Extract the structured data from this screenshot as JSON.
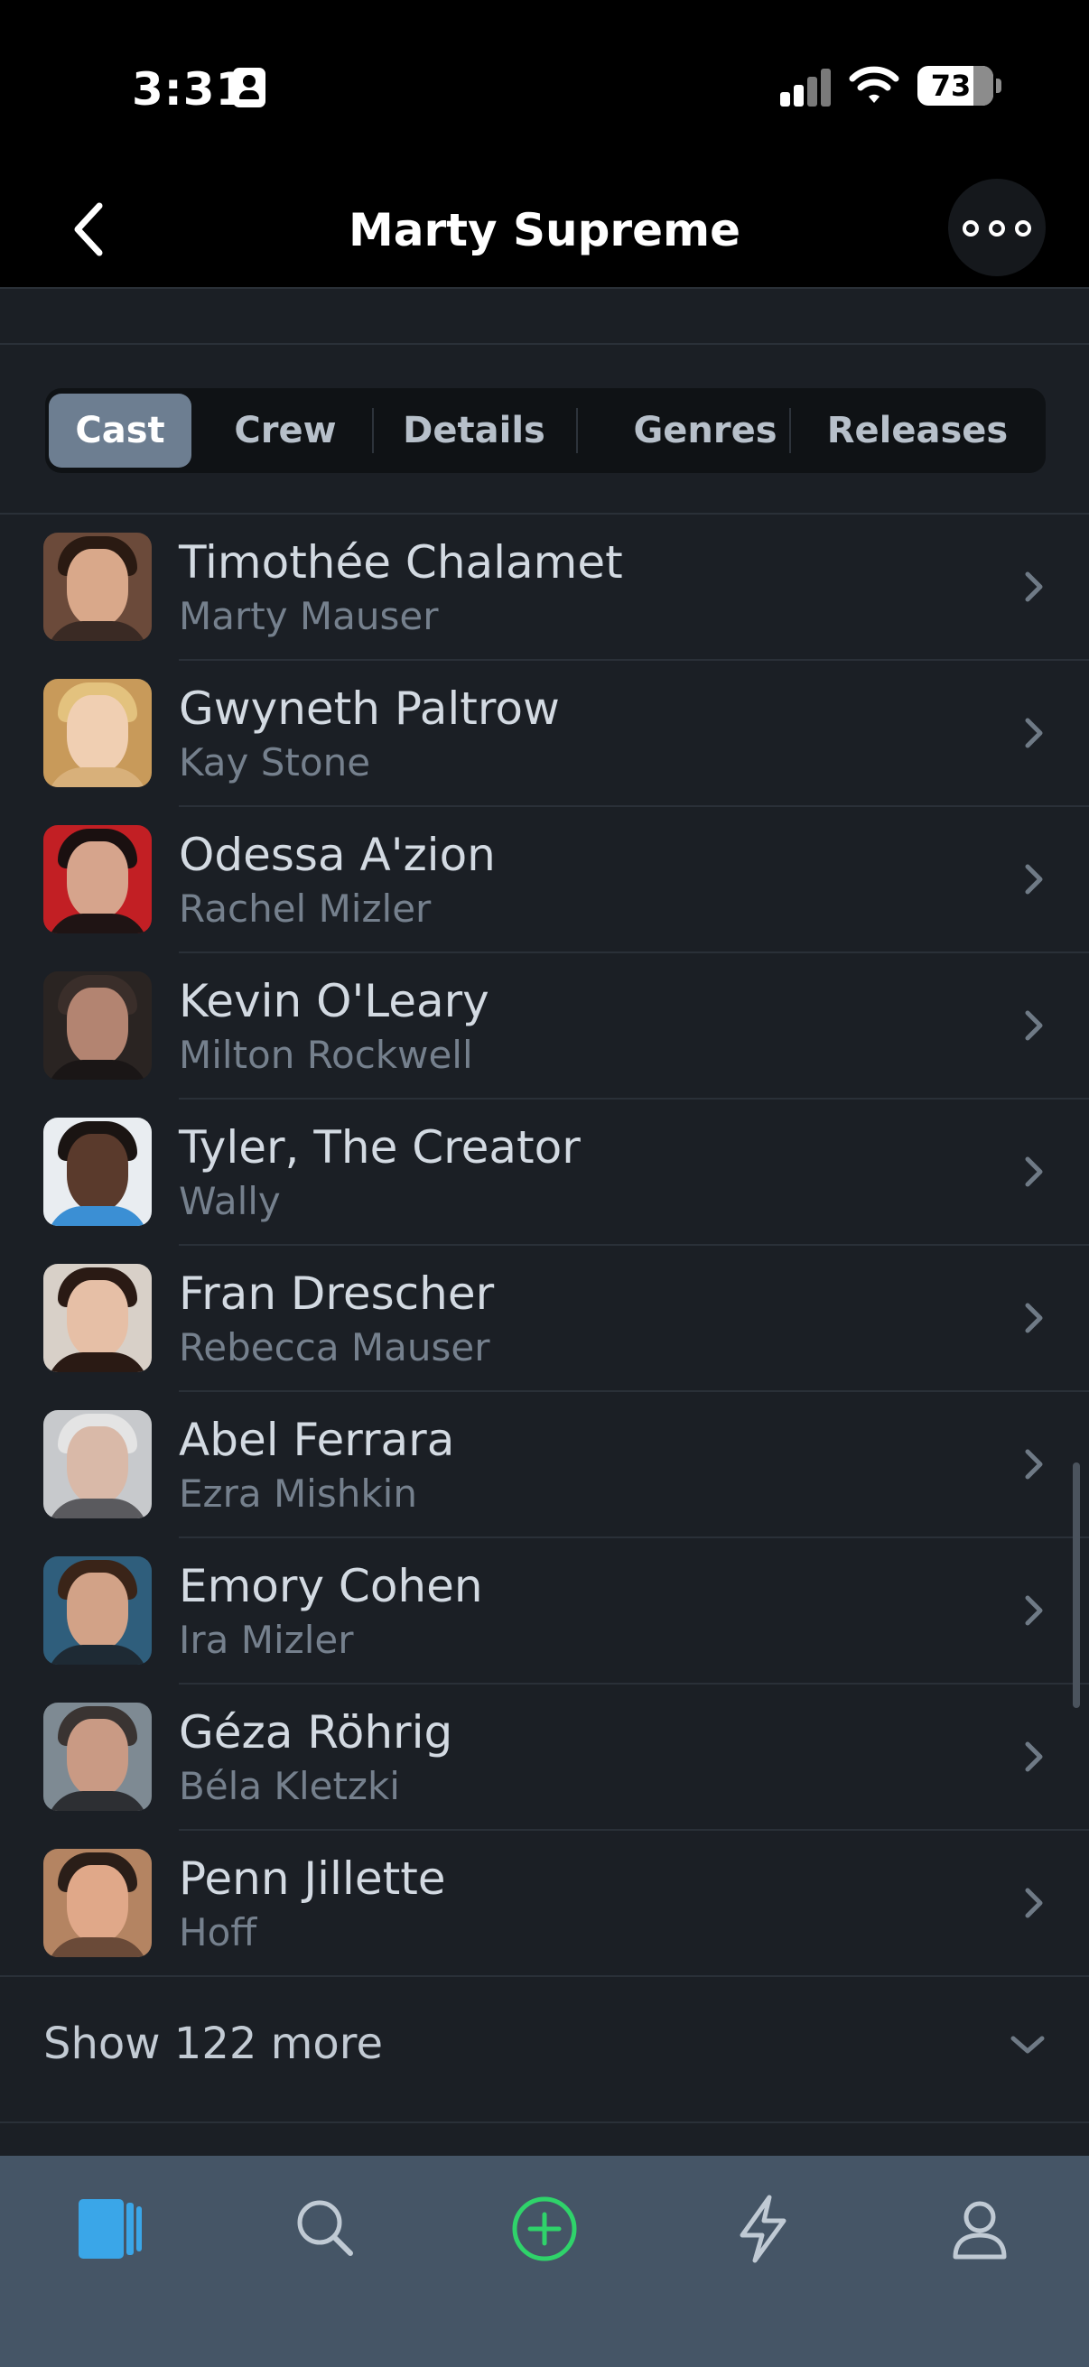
{
  "status_bar": {
    "time": "3:31",
    "battery": "73",
    "icons": [
      "id-card-icon",
      "signal-icon",
      "wifi-icon",
      "battery-icon"
    ]
  },
  "header": {
    "title": "Marty Supreme",
    "back_icon": "chevron-left-icon",
    "more_icon": "ellipsis-icon"
  },
  "tabs": [
    {
      "label": "Cast",
      "active": true
    },
    {
      "label": "Crew",
      "active": false
    },
    {
      "label": "Details",
      "active": false
    },
    {
      "label": "Genres",
      "active": false
    },
    {
      "label": "Releases",
      "active": false
    }
  ],
  "cast": [
    {
      "actor": "Timothée Chalamet",
      "role": "Marty Mauser"
    },
    {
      "actor": "Gwyneth Paltrow",
      "role": "Kay Stone"
    },
    {
      "actor": "Odessa A'zion",
      "role": "Rachel Mizler"
    },
    {
      "actor": "Kevin O'Leary",
      "role": "Milton Rockwell"
    },
    {
      "actor": "Tyler, The Creator",
      "role": "Wally"
    },
    {
      "actor": "Fran Drescher",
      "role": "Rebecca Mauser"
    },
    {
      "actor": "Abel Ferrara",
      "role": "Ezra Mishkin"
    },
    {
      "actor": "Emory Cohen",
      "role": "Ira Mizler"
    },
    {
      "actor": "Géza Röhrig",
      "role": "Béla Kletzki"
    },
    {
      "actor": "Penn Jillette",
      "role": "Hoff"
    }
  ],
  "show_more": {
    "label": "Show 122 more"
  },
  "tab_bar": [
    {
      "name": "library-icon",
      "active": true
    },
    {
      "name": "search-icon",
      "active": false
    },
    {
      "name": "add-circle-icon",
      "active": false
    },
    {
      "name": "lightning-icon",
      "active": false
    },
    {
      "name": "profile-icon",
      "active": false
    }
  ],
  "colors": {
    "background": "#1b1f25",
    "tab_active": "#6d7e91",
    "tab_bar": "#455566",
    "accent_green": "#2fd36a",
    "accent_blue": "#3aa6e8"
  }
}
